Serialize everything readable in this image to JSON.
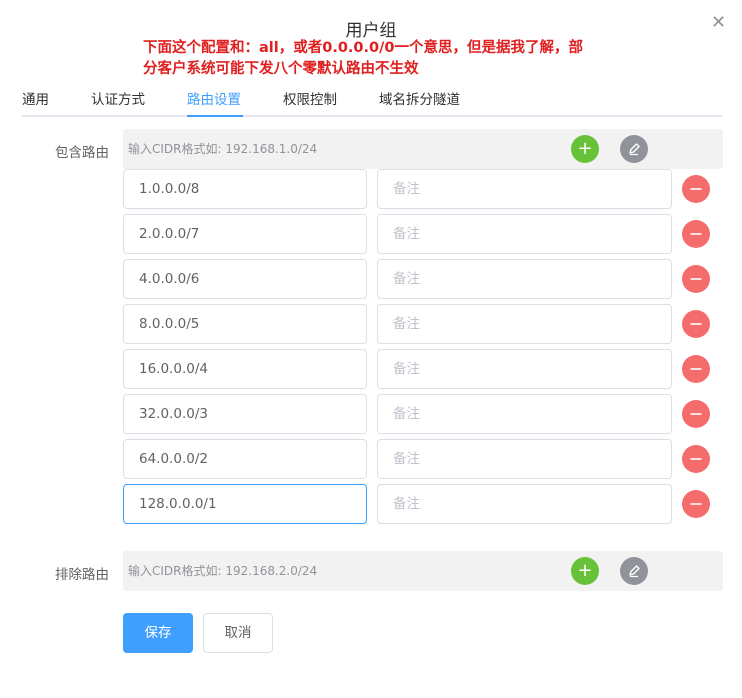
{
  "dialog": {
    "title": "用户组",
    "close_icon": "close-icon"
  },
  "notice": {
    "color": "#e02020",
    "part1": "下面这个配置和：",
    "part2": "all",
    "part3": "，或者",
    "part4": "0.0.0.0/0",
    "part5": "一个意思，但是据我了解，部分客户系统可能下发八个零默认路由不生效"
  },
  "tabs": [
    {
      "label": "通用"
    },
    {
      "label": "认证方式"
    },
    {
      "label": "路由设置"
    },
    {
      "label": "权限控制"
    },
    {
      "label": "域名拆分隧道"
    }
  ],
  "active_tab": "路由设置",
  "include": {
    "label": "包含路由",
    "placeholder": "输入CIDR格式如: 192.168.1.0/24",
    "note_placeholder": "备注",
    "routes": [
      {
        "cidr": "1.0.0.0/8",
        "note": ""
      },
      {
        "cidr": "2.0.0.0/7",
        "note": ""
      },
      {
        "cidr": "4.0.0.0/6",
        "note": ""
      },
      {
        "cidr": "8.0.0.0/5",
        "note": ""
      },
      {
        "cidr": "16.0.0.0/4",
        "note": ""
      },
      {
        "cidr": "32.0.0.0/3",
        "note": ""
      },
      {
        "cidr": "64.0.0.0/2",
        "note": ""
      },
      {
        "cidr": "128.0.0.0/1",
        "note": ""
      }
    ]
  },
  "exclude": {
    "label": "排除路由",
    "placeholder": "输入CIDR格式如: 192.168.2.0/24"
  },
  "buttons": {
    "save": "保存",
    "cancel": "取消"
  },
  "icons": {
    "add": "plus-icon",
    "edit": "pencil-icon",
    "delete": "minus-icon"
  },
  "colors": {
    "accent": "#409eff",
    "add": "#67c23a",
    "delete": "#f56c6c",
    "edit": "#909399"
  }
}
